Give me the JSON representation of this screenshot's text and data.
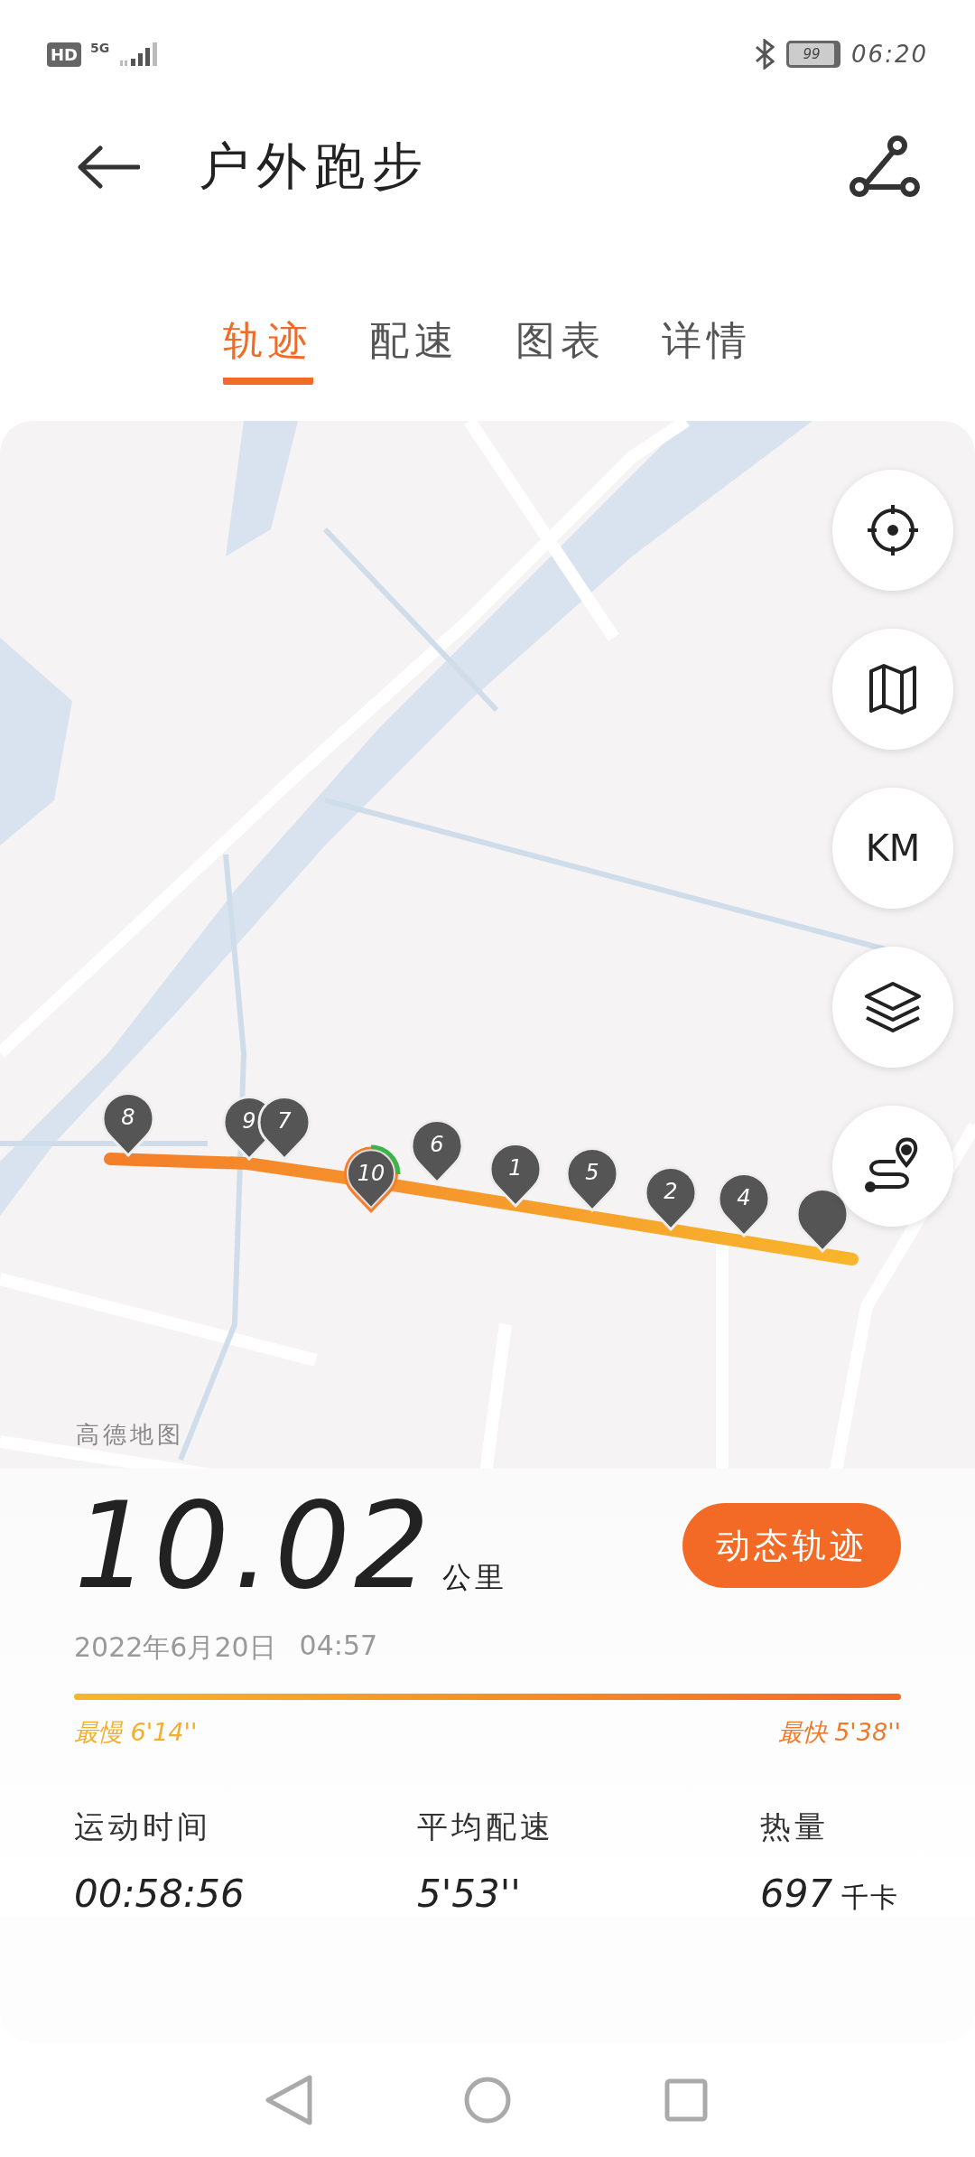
{
  "status_bar": {
    "hd": "HD",
    "network": "5G",
    "battery": "99",
    "time": "06:20"
  },
  "header": {
    "title": "户外跑步"
  },
  "tabs": [
    {
      "label": "轨迹",
      "selected": true
    },
    {
      "label": "配速",
      "selected": false
    },
    {
      "label": "图表",
      "selected": false
    },
    {
      "label": "详情",
      "selected": false
    }
  ],
  "map": {
    "attribution": "高德地图",
    "markers": [
      {
        "label": "8",
        "kind": "lap"
      },
      {
        "label": "9",
        "kind": "lap"
      },
      {
        "label": "7",
        "kind": "lap"
      },
      {
        "label": "6",
        "kind": "lap"
      },
      {
        "label": "1",
        "kind": "lap"
      },
      {
        "label": "5",
        "kind": "lap"
      },
      {
        "label": "2",
        "kind": "lap"
      },
      {
        "label": "4",
        "kind": "lap"
      },
      {
        "kind": "lap"
      },
      {
        "label": "10",
        "kind": "finish"
      }
    ],
    "buttons": [
      {
        "kind": "locate"
      },
      {
        "kind": "map"
      },
      {
        "kind": "text",
        "label": "KM"
      },
      {
        "kind": "layers"
      },
      {
        "kind": "route"
      }
    ]
  },
  "summary": {
    "distance": "10.02",
    "unit": "公里",
    "action": "动态轨迹",
    "date": "2022年6月20日",
    "time": "04:57",
    "slowest": {
      "label": "最慢",
      "value": "6'14''"
    },
    "fastest": {
      "label": "最快",
      "value": "5'38''"
    },
    "stats": [
      {
        "label": "运动时间",
        "value": "00:58:56"
      },
      {
        "label": "平均配速",
        "value": "5'53''"
      },
      {
        "label": "热量",
        "value": "697",
        "unit": "千卡"
      }
    ]
  }
}
